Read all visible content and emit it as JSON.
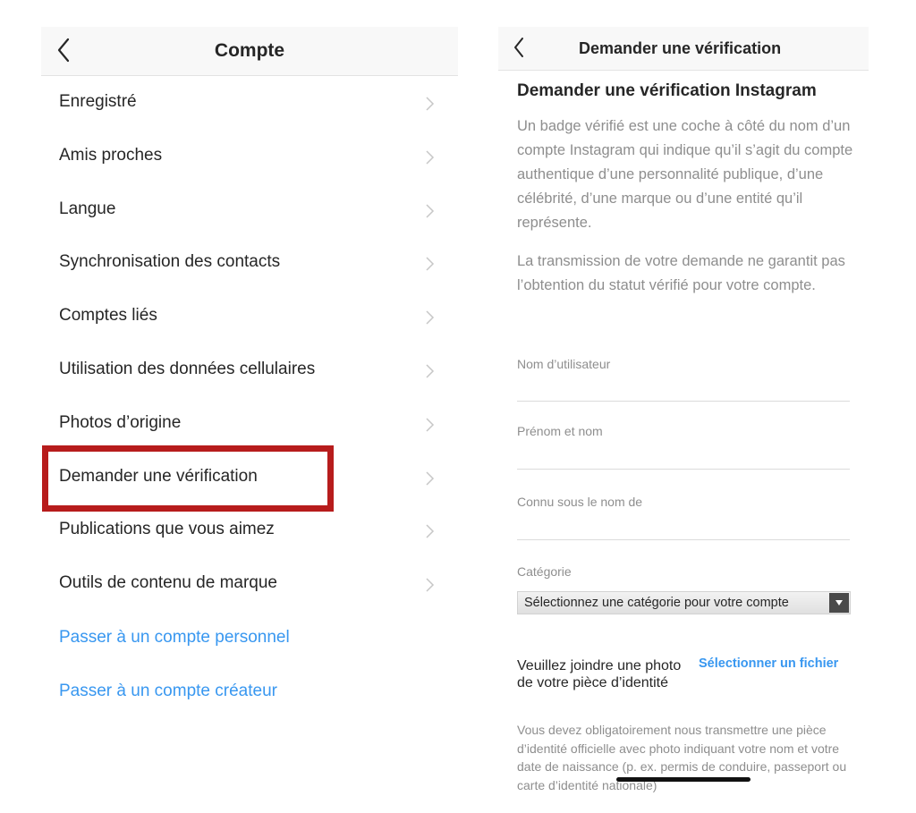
{
  "left": {
    "header": {
      "title": "Compte"
    },
    "menu": [
      {
        "label": "Enregistré"
      },
      {
        "label": "Amis proches"
      },
      {
        "label": "Langue"
      },
      {
        "label": "Synchronisation des contacts"
      },
      {
        "label": "Comptes liés"
      },
      {
        "label": "Utilisation des données cellulaires"
      },
      {
        "label": "Photos d’origine"
      },
      {
        "label": "Demander une vérification"
      },
      {
        "label": "Publications que vous aimez"
      },
      {
        "label": "Outils de contenu de marque"
      }
    ],
    "links": [
      {
        "label": "Passer à un compte personnel"
      },
      {
        "label": "Passer à un compte créateur"
      }
    ],
    "highlight_color": "#b71c1c"
  },
  "right": {
    "header": {
      "title": "Demander une vérification"
    },
    "heading": "Demander une vérification Instagram",
    "paragraph1": "Un badge vérifié est une coche à côté du nom d’un compte Instagram qui indique qu’il s’agit du compte authentique d’une personnalité publique, d’une célébrité, d’une marque ou d’une entité qu’il représente.",
    "paragraph2": "La transmission de votre demande ne garantit pas l’obtention du statut vérifié pour votre compte.",
    "fields": {
      "username": {
        "label": "Nom d’utilisateur",
        "value": ""
      },
      "full_name": {
        "label": "Prénom et nom",
        "value": ""
      },
      "known_as": {
        "label": "Connu sous le nom de",
        "value": ""
      }
    },
    "category": {
      "label": "Catégorie",
      "selected": "Sélectionnez une catégorie pour votre compte"
    },
    "attach": {
      "label": "Veuillez joindre une photo de votre pièce d’identité",
      "button": "Sélectionner un fichier"
    },
    "note": "Vous devez obligatoirement nous transmettre une pièce d’identité officielle avec photo indiquant votre nom et votre date de naissance (p. ex. permis de conduire, passeport ou carte d’identité nationale)"
  },
  "colors": {
    "link": "#3897f0",
    "text": "#262626",
    "secondary_text": "#8e8e8e"
  }
}
